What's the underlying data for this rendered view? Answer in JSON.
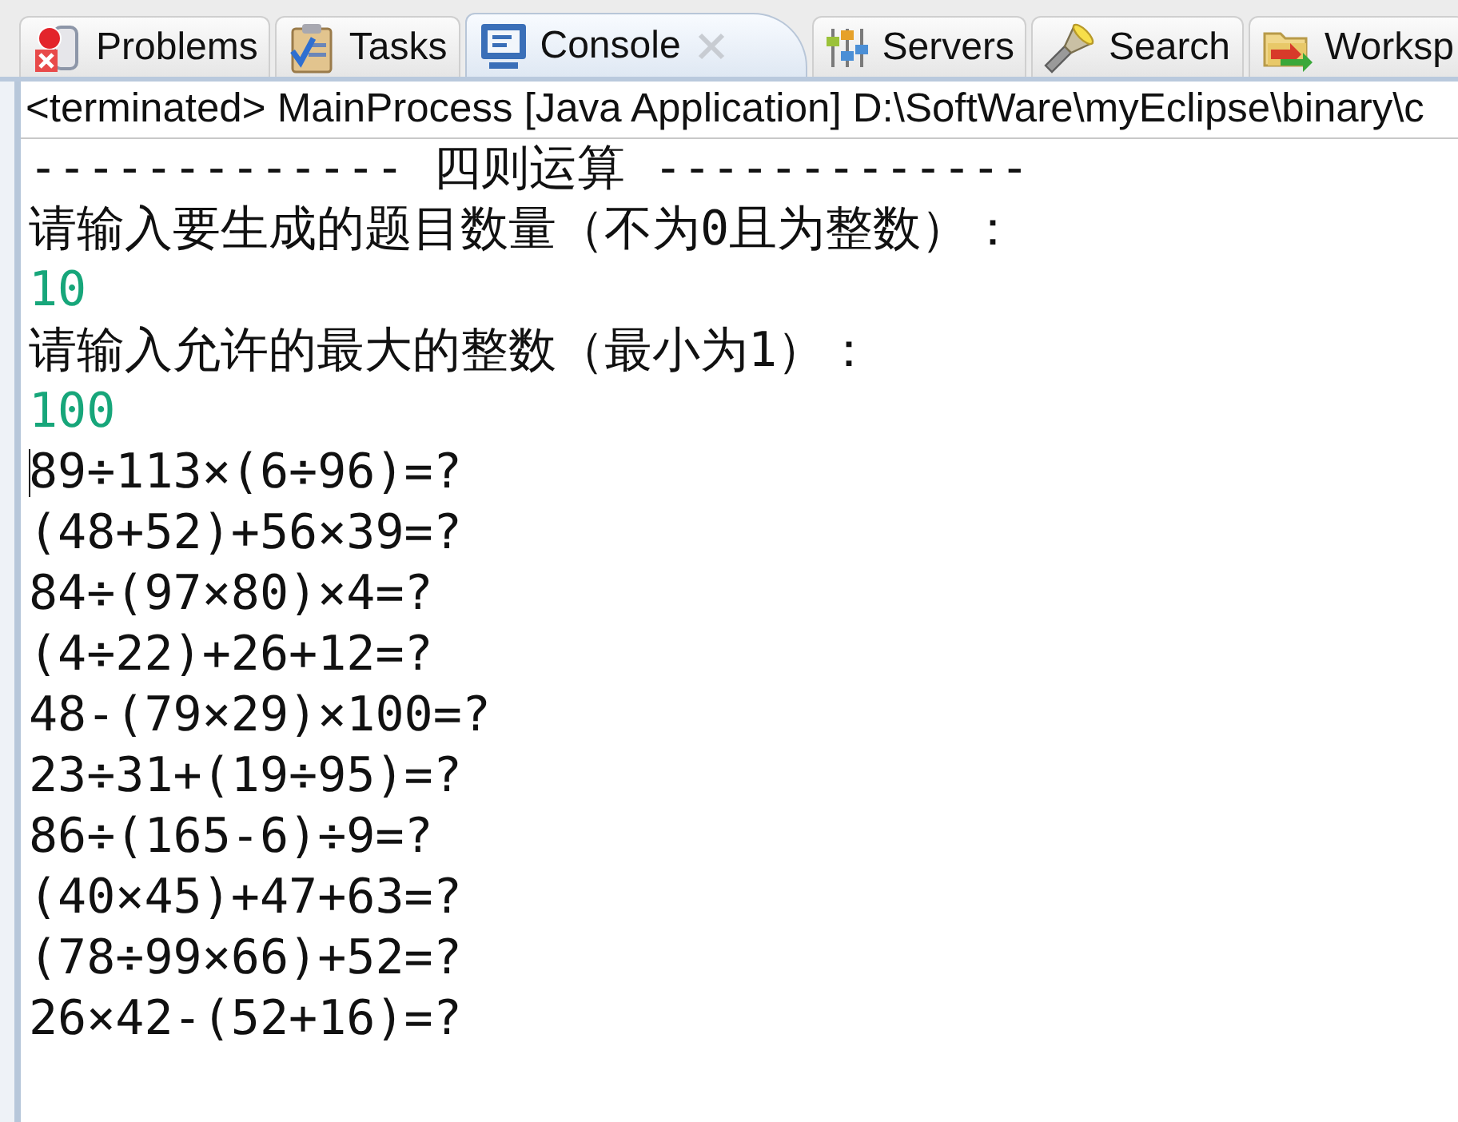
{
  "tabs": [
    {
      "label": "Problems",
      "selected": false
    },
    {
      "label": "Tasks",
      "selected": false
    },
    {
      "label": "Console",
      "selected": true
    },
    {
      "label": "Servers",
      "selected": false
    },
    {
      "label": "Search",
      "selected": false
    },
    {
      "label": "Worksp",
      "selected": false
    }
  ],
  "process_label": "<terminated> MainProcess [Java Application] D:\\SoftWare\\myEclipse\\binary\\c",
  "console_lines": [
    {
      "kind": "heading",
      "text": "------------- 四则运算 -------------",
      "caret": false
    },
    {
      "kind": "prompt",
      "text": "请输入要生成的题目数量（不为0且为整数）：",
      "caret": false
    },
    {
      "kind": "input",
      "text": "10",
      "caret": false
    },
    {
      "kind": "prompt",
      "text": "请输入允许的最大的整数（最小为1）：",
      "caret": false
    },
    {
      "kind": "input",
      "text": "100",
      "caret": false
    },
    {
      "kind": "output",
      "text": "89÷113×(6÷96)=?",
      "caret": true
    },
    {
      "kind": "output",
      "text": "(48+52)+56×39=?",
      "caret": false
    },
    {
      "kind": "output",
      "text": "84÷(97×80)×4=?",
      "caret": false
    },
    {
      "kind": "output",
      "text": "(4÷22)+26+12=?",
      "caret": false
    },
    {
      "kind": "output",
      "text": "48-(79×29)×100=?",
      "caret": false
    },
    {
      "kind": "output",
      "text": "23÷31+(19÷95)=?",
      "caret": false
    },
    {
      "kind": "output",
      "text": "86÷(165-6)÷9=?",
      "caret": false
    },
    {
      "kind": "output",
      "text": "(40×45)+47+63=?",
      "caret": false
    },
    {
      "kind": "output",
      "text": "(78÷99×66)+52=?",
      "caret": false
    },
    {
      "kind": "output",
      "text": "26×42-(52+16)=?",
      "caret": false
    }
  ]
}
